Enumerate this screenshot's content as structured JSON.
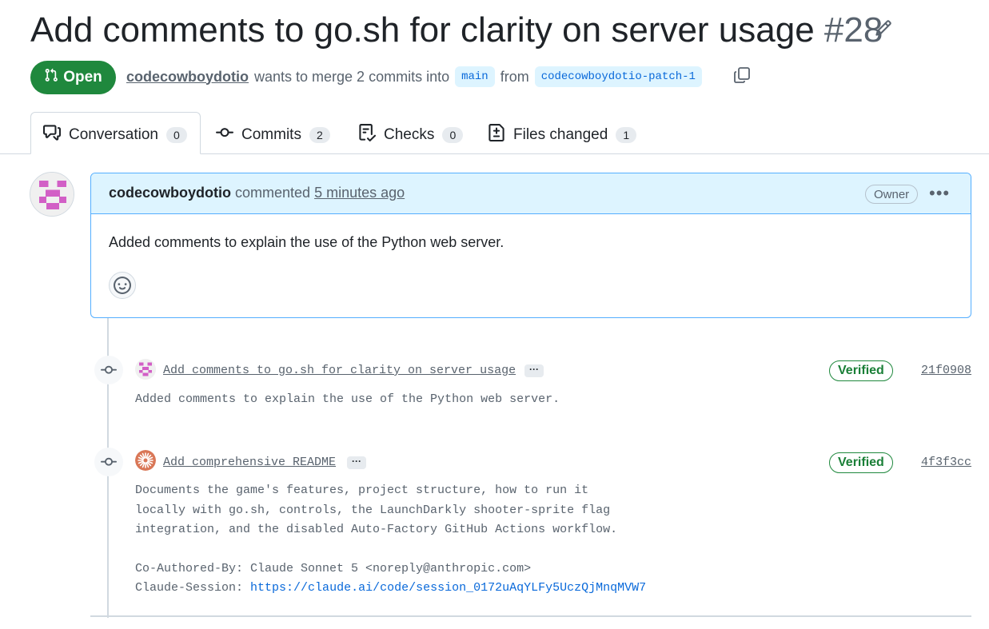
{
  "pr": {
    "title": "Add comments to go.sh for clarity on server usage",
    "number": "#28",
    "state": "Open",
    "author": "codecowboydotio",
    "merge_text": "wants to merge 2 commits into",
    "base_branch": "main",
    "from_text": "from",
    "head_branch": "codecowboydotio-patch-1"
  },
  "tabs": [
    {
      "label": "Conversation",
      "count": "0",
      "icon": "conversation-icon"
    },
    {
      "label": "Commits",
      "count": "2",
      "icon": "commit-icon"
    },
    {
      "label": "Checks",
      "count": "0",
      "icon": "checklist-icon"
    },
    {
      "label": "Files changed",
      "count": "1",
      "icon": "file-diff-icon"
    }
  ],
  "comment": {
    "author": "codecowboydotio",
    "action": "commented",
    "time": "5 minutes ago",
    "role": "Owner",
    "body": "Added comments to explain the use of the Python web server."
  },
  "commits": [
    {
      "message": "Add comments to go.sh for clarity on server usage",
      "status": "Verified",
      "sha": "21f0908",
      "body": "Added comments to explain the use of the Python web server.",
      "avatar": "identicon"
    },
    {
      "message": "Add comprehensive README",
      "status": "Verified",
      "sha": "4f3f3cc",
      "body": "Documents the game's features, project structure, how to run it\nlocally with go.sh, controls, the LaunchDarkly shooter-sprite flag\nintegration, and the disabled Auto-Factory GitHub Actions workflow.\n\nCo-Authored-By: Claude Sonnet 5 <noreply@anthropic.com>",
      "session_label": "Claude-Session:",
      "session_url": "https://claude.ai/code/session_0172uAqYLFy5UczQjMnqMVW7",
      "avatar": "claude-logo"
    }
  ],
  "colors": {
    "open_green": "#1f883d",
    "accent_blue": "#0969da",
    "comment_header_bg": "#ddf4ff",
    "identicon_pink": "#d25fc6"
  }
}
